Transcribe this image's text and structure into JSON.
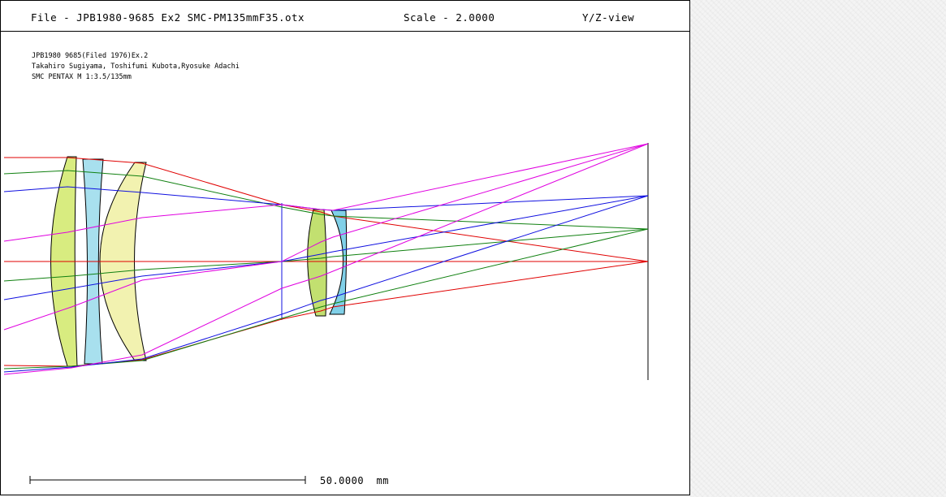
{
  "header": {
    "file_label": "File - JPB1980-9685 Ex2 SMC-PM135mmF35.otx",
    "scale_label": "Scale - 2.0000",
    "view_label": "Y/Z-view"
  },
  "info": {
    "line1": "JPB1980 9685(Filed 1976)Ex.2",
    "line2": "Takahiro Sugiyama, Toshifumi Kubota,Ryosuke Adachi",
    "line3": "SMC PENTAX M 1:3.5/135mm"
  },
  "scale_bar": {
    "label": "50.0000  mm"
  },
  "colors": {
    "ray_red": "#e00000",
    "ray_green": "#108010",
    "ray_blue": "#1010e0",
    "ray_magenta": "#e000e0",
    "glass_yellow_green": "#d8ec80",
    "glass_light_yellow": "#f2f2b0",
    "glass_cyan": "#a8e0ee",
    "glass_green": "#c2e070",
    "glass_blue": "#80d0e8"
  }
}
